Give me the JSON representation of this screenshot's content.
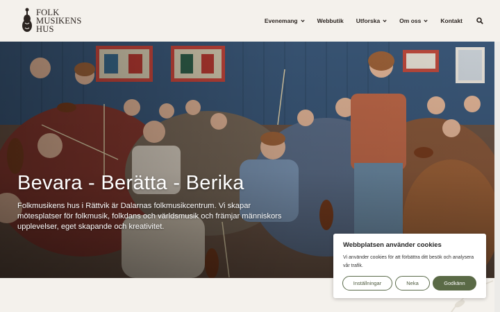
{
  "logo": {
    "line1": "FOLK",
    "line2": "MUSIKENS",
    "line3": "HUS"
  },
  "nav": {
    "items": [
      {
        "label": "Evenemang",
        "dropdown": true
      },
      {
        "label": "Webbutik",
        "dropdown": false
      },
      {
        "label": "Utforska",
        "dropdown": true
      },
      {
        "label": "Om oss",
        "dropdown": true
      },
      {
        "label": "Kontakt",
        "dropdown": false
      }
    ],
    "search_icon": "search-icon"
  },
  "hero": {
    "title": "Bevara - Berätta - Berika",
    "text": "Folkmusikens hus i Rättvik är Dalarnas folkmusikcentrum. Vi skapar mötesplatser för folkmusik, folkdans och världsmusik och främjar människors upplevelser, eget skapande och kreativitet."
  },
  "cookie": {
    "title": "Webbplatsen använder cookies",
    "text": "Vi använder cookies för att förbättra ditt besök och analysera vår trafik.",
    "settings_label": "Inställningar",
    "deny_label": "Neka",
    "accept_label": "Godkänn"
  },
  "colors": {
    "background": "#f4f1ec",
    "text_dark": "#2b2420",
    "accent_green": "#5a6a46"
  }
}
